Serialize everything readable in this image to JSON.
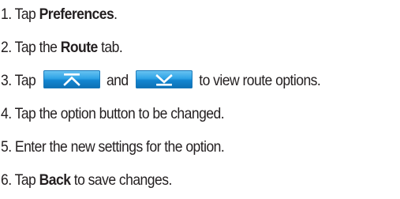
{
  "steps": [
    {
      "num": "1.",
      "pre": "Tap ",
      "bold": "Preferences",
      "post": "."
    },
    {
      "num": "2.",
      "pre": "Tap the ",
      "bold": "Route",
      "post": " tab."
    },
    {
      "num": "3.",
      "pre": "Tap ",
      "mid": " and ",
      "post": " to view route options."
    },
    {
      "num": "4.",
      "text": "Tap the option button to be changed."
    },
    {
      "num": "5.",
      "text": "Enter the new settings for the option."
    },
    {
      "num": "6.",
      "pre": "Tap ",
      "bold": "Back",
      "post": " to save changes."
    }
  ],
  "icons": {
    "up_button": "scroll-up-arrow",
    "down_button": "scroll-down-arrow"
  },
  "colors": {
    "text": "#231f20",
    "button_top": "#6ec6f3",
    "button_bottom": "#0d6fb3",
    "arrow": "#ffffff"
  }
}
